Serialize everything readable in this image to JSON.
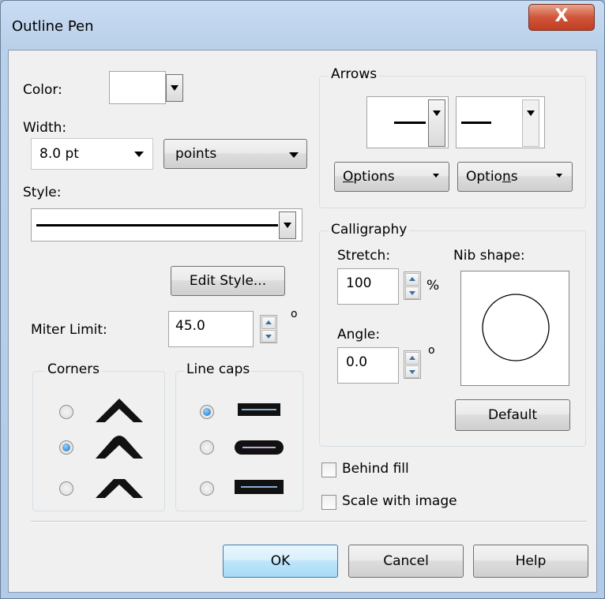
{
  "window": {
    "title": "Outline Pen",
    "close_glyph": "X"
  },
  "color": {
    "label": "Color:",
    "swatch": "#ffffff"
  },
  "width": {
    "label": "Width:",
    "value": "8.0 pt",
    "units": "points"
  },
  "style": {
    "label": "Style:",
    "edit_button": "Edit Style..."
  },
  "miter": {
    "label": "Miter Limit:",
    "value": "45.0",
    "unit": "o"
  },
  "corners": {
    "title": "Corners",
    "selected_index": 1,
    "options": [
      "miter-corner-icon",
      "round-corner-icon",
      "bevel-corner-icon"
    ]
  },
  "line_caps": {
    "title": "Line caps",
    "selected_index": 0,
    "options": [
      "butt-cap-icon",
      "round-cap-icon",
      "square-cap-icon"
    ]
  },
  "arrows": {
    "title": "Arrows",
    "left_options_pre": "",
    "left_options_u": "O",
    "left_options_post": "ptions",
    "right_options_pre": "Optio",
    "right_options_u": "n",
    "right_options_post": "s"
  },
  "calligraphy": {
    "title": "Calligraphy",
    "stretch_label": "Stretch:",
    "stretch_value": "100",
    "stretch_unit": "%",
    "nib_label": "Nib shape:",
    "angle_label": "Angle:",
    "angle_value": "0.0",
    "angle_unit": "o",
    "default_button": "Default"
  },
  "checkboxes": {
    "behind_fill": "Behind fill",
    "behind_fill_checked": false,
    "scale_with_image": "Scale with image",
    "scale_with_image_checked": false
  },
  "footer": {
    "ok": "OK",
    "cancel": "Cancel",
    "help": "Help"
  },
  "colors": {
    "accent": "#1e6bb8",
    "close": "#c9462c",
    "dialog_bg": "#f0f0f0"
  }
}
